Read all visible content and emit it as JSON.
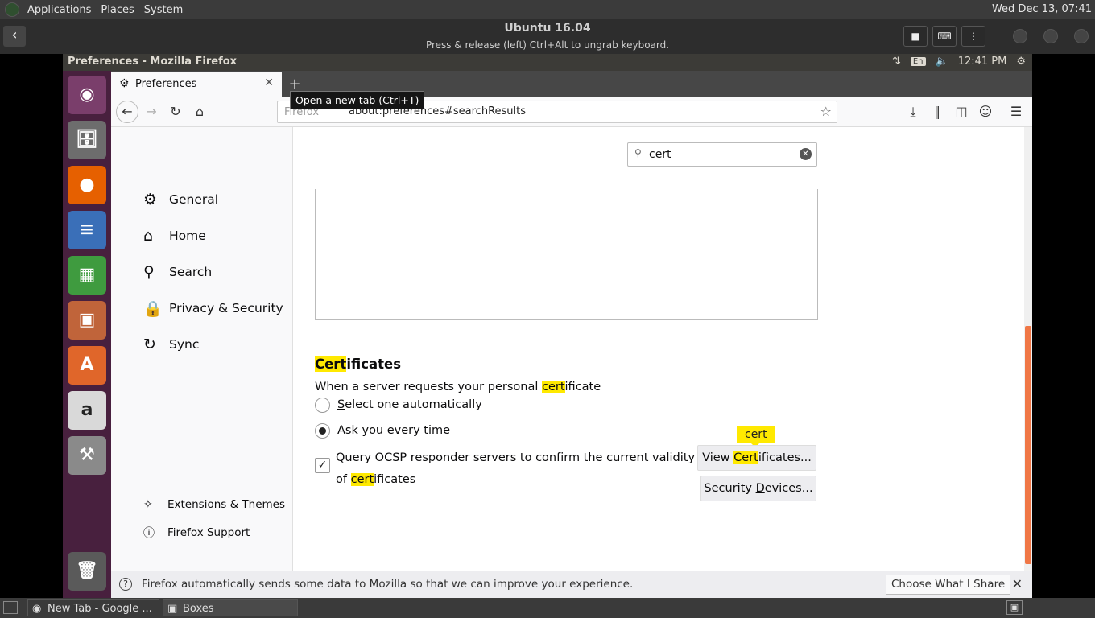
{
  "host_panel": {
    "menus": [
      "Applications",
      "Places",
      "System"
    ],
    "clock": "Wed Dec 13, 07:41"
  },
  "boxes": {
    "title": "Ubuntu 16.04",
    "subtitle": "Press & release (left) Ctrl+Alt to ungrab keyboard."
  },
  "guest_panel": {
    "window_title": "Preferences - Mozilla Firefox",
    "lang": "En",
    "time": "12:41 PM"
  },
  "launcher": {
    "items": [
      "ubuntu-dash",
      "files",
      "firefox",
      "writer",
      "calc",
      "impress",
      "software-center",
      "amazon",
      "system-settings",
      "trash"
    ]
  },
  "browser": {
    "tab_label": "Preferences",
    "tooltip": "Open a new tab (Ctrl+T)",
    "identity": "Firefox",
    "url": "about:preferences#searchResults"
  },
  "prefs": {
    "categories": [
      {
        "label": "General",
        "icon": "gear-icon"
      },
      {
        "label": "Home",
        "icon": "home-icon"
      },
      {
        "label": "Search",
        "icon": "search-icon"
      },
      {
        "label": "Privacy & Security",
        "icon": "lock-icon"
      },
      {
        "label": "Sync",
        "icon": "sync-icon"
      }
    ],
    "footer_links": [
      {
        "label": "Extensions & Themes",
        "icon": "puzzle-icon"
      },
      {
        "label": "Firefox Support",
        "icon": "help-icon"
      }
    ],
    "search_value": "cert",
    "section": {
      "title_hl": "Cert",
      "title_rest": "ificates",
      "desc_pre": "When a server requests your personal ",
      "desc_hl": "cert",
      "desc_post": "ificate",
      "radio1_ul": "S",
      "radio1_rest": "elect one automatically",
      "radio2_ul": "A",
      "radio2_rest": "sk you every time",
      "check_pre": "Query OCSP responder servers to confirm the current validity of ",
      "check_hl": "cert",
      "check_post": "ificates",
      "bubble": "cert",
      "view_pre": "View ",
      "view_hl": "Cert",
      "view_post": "ificates...",
      "devices_pre": "Security ",
      "devices_ul": "D",
      "devices_post": "evices..."
    }
  },
  "notification": {
    "message": "Firefox automatically sends some data to Mozilla so that we can improve your experience.",
    "button": "Choose What I Share"
  },
  "taskbar": {
    "tasks": [
      "New Tab - Google ...",
      "Boxes"
    ]
  }
}
